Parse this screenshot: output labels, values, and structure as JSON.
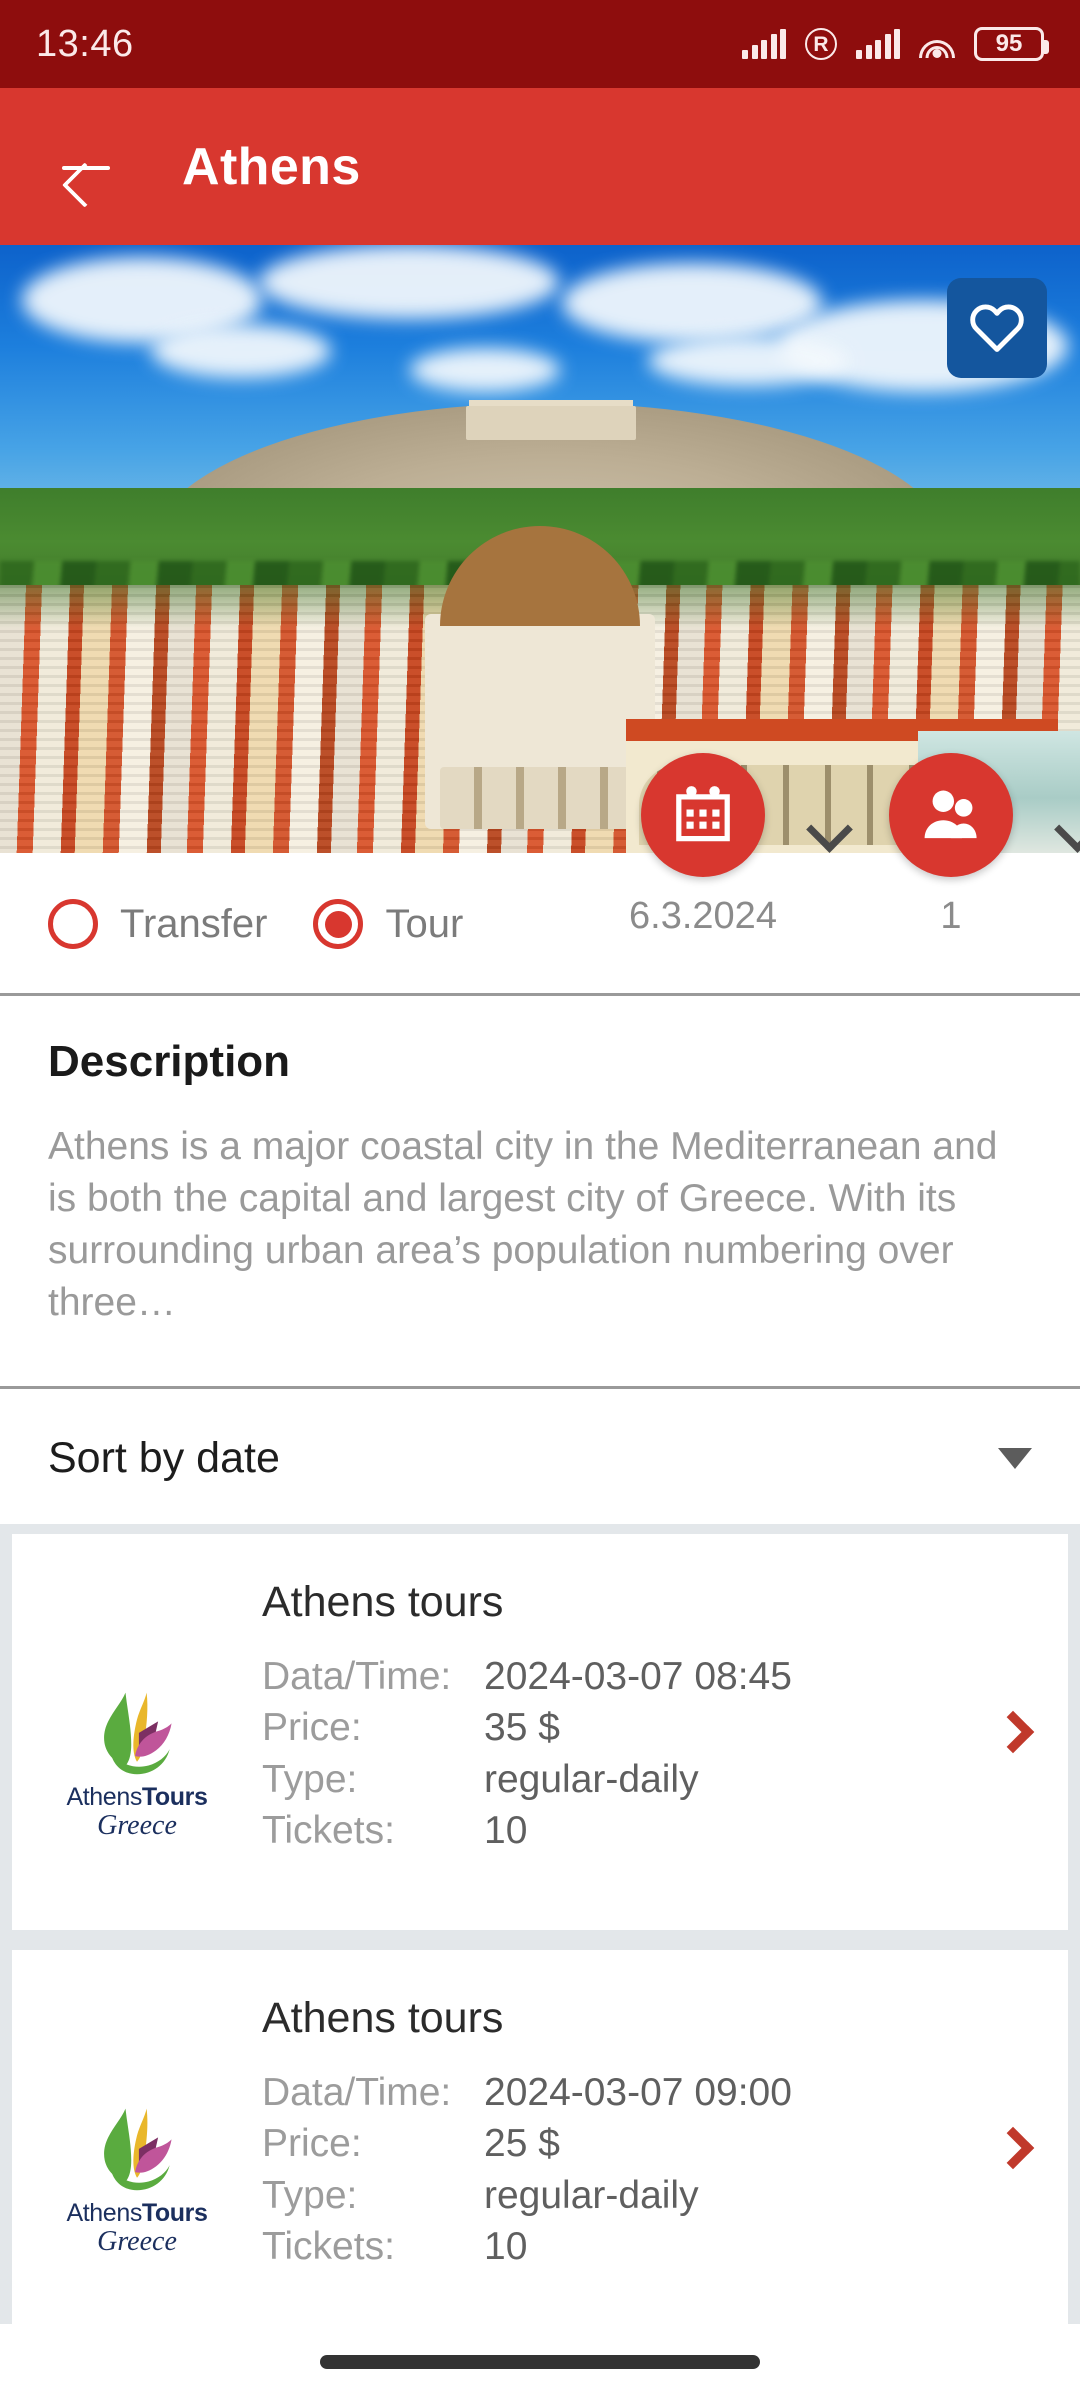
{
  "status_bar": {
    "time": "13:46",
    "battery_level": "95",
    "icons": [
      "signal-icon",
      "roaming-icon",
      "signal-icon",
      "wifi-icon",
      "battery-icon"
    ],
    "roaming_glyph": "R"
  },
  "app_bar": {
    "back_label": "back-arrow",
    "title": "Athens"
  },
  "hero": {
    "alt": "Athens Acropolis cityscape",
    "favorite_icon": "heart-icon",
    "favorite_active": false,
    "favorite_bg": "#14569e"
  },
  "filters": {
    "options": [
      {
        "label": "Transfer",
        "selected": false
      },
      {
        "label": "Tour",
        "selected": true
      }
    ],
    "date_picker": {
      "icon": "calendar-icon",
      "value": "6.3.2024",
      "chevron": "chevron-down-icon"
    },
    "people_picker": {
      "icon": "people-icon",
      "value": "1",
      "chevron": "chevron-down-icon"
    }
  },
  "description": {
    "heading": "Description",
    "text": "Athens is a major coastal city in the Mediterranean and is both the capital and largest city of Greece. With its surrounding urban area’s population numbering over three…"
  },
  "sort": {
    "label": "Sort by date",
    "caret": "caret-down-icon"
  },
  "list": {
    "labels": {
      "datetime": "Data/Time:",
      "price": "Price:",
      "type": "Type:",
      "tickets": "Tickets:"
    },
    "logo": {
      "line1_a": "Athens",
      "line1_b": "Tours",
      "line2": "Greece"
    },
    "items": [
      {
        "title": "Athens tours",
        "datetime": "2024-03-07 08:45",
        "price": "35 $",
        "type": "regular-daily",
        "tickets": "10",
        "chevron": "chevron-right-icon"
      },
      {
        "title": "Athens tours",
        "datetime": "2024-03-07 09:00",
        "price": "25 $",
        "type": "regular-daily",
        "tickets": "10",
        "chevron": "chevron-right-icon"
      }
    ]
  },
  "nav_bar": {
    "home_indicator": "home-indicator"
  },
  "colors": {
    "status_bar_bg": "#8e0d0d",
    "app_bar_bg": "#d8372f",
    "accent": "#d8372f",
    "list_bg": "#e3e7ea",
    "muted_text": "#9a9a9a"
  }
}
